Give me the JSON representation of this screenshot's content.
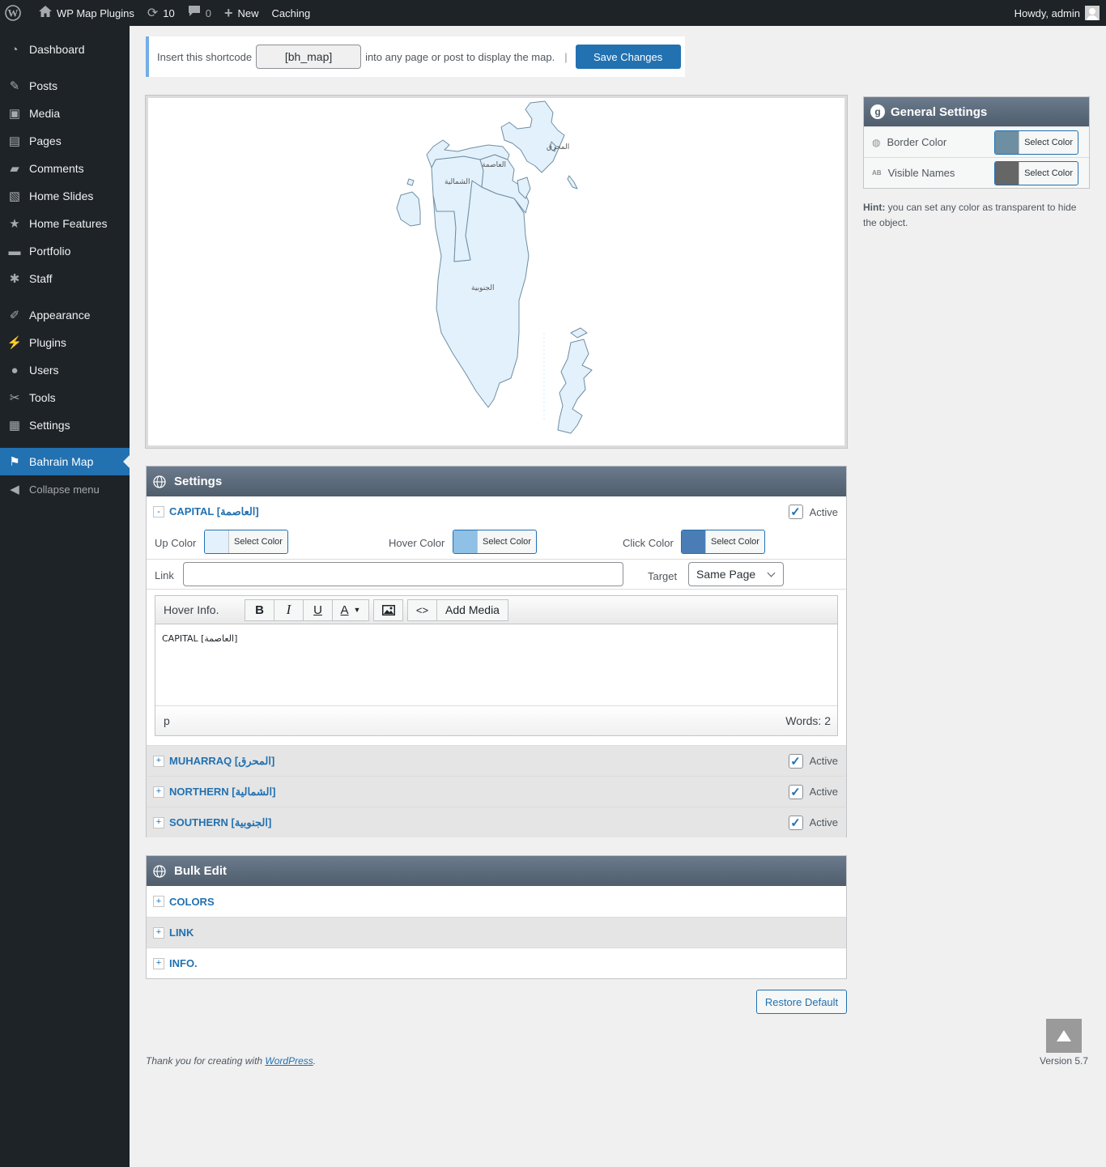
{
  "adminbar": {
    "site_name": "WP Map Plugins",
    "updates_count": "10",
    "comments_count": "0",
    "new_label": "New",
    "caching_label": "Caching",
    "howdy": "Howdy, admin"
  },
  "sidebar": {
    "items": [
      {
        "label": "Dashboard",
        "icon": "dashboard-icon"
      },
      {
        "label": "Posts",
        "icon": "pushpin-icon"
      },
      {
        "label": "Media",
        "icon": "media-icon"
      },
      {
        "label": "Pages",
        "icon": "page-icon"
      },
      {
        "label": "Comments",
        "icon": "comment-icon"
      },
      {
        "label": "Home Slides",
        "icon": "slides-icon"
      },
      {
        "label": "Home Features",
        "icon": "star-icon"
      },
      {
        "label": "Portfolio",
        "icon": "folder-icon"
      },
      {
        "label": "Staff",
        "icon": "paw-icon"
      },
      {
        "label": "Appearance",
        "icon": "brush-icon"
      },
      {
        "label": "Plugins",
        "icon": "plug-icon"
      },
      {
        "label": "Users",
        "icon": "user-icon"
      },
      {
        "label": "Tools",
        "icon": "wrench-icon"
      },
      {
        "label": "Settings",
        "icon": "settings-icon"
      },
      {
        "label": "Bahrain Map",
        "icon": "map-pin-icon"
      },
      {
        "label": "Collapse menu",
        "icon": "collapse-icon"
      }
    ]
  },
  "shortcode": {
    "prefix": "Insert this shortcode",
    "value": "[bh_map]",
    "suffix": "into any page or post to display the map.",
    "separator": "|",
    "save_label": "Save Changes"
  },
  "map": {
    "labels": {
      "muharraq": "المحرق",
      "capital": "العاصمة",
      "northern": "الشمالية",
      "southern": "الجنوبية"
    },
    "fill_color": "#e3f1fc",
    "border_color": "#6e8ea1"
  },
  "settings_panel": {
    "title": "Settings",
    "active_label": "Active",
    "capital": {
      "title": "CAPITAL [العاصمة]",
      "toggle": "-",
      "up_color_label": "Up Color",
      "up_color": "#e3f1fc",
      "hover_color_label": "Hover Color",
      "hover_color": "#8fc0e6",
      "click_color_label": "Click Color",
      "click_color": "#4a7db5",
      "select_color_label": "Select Color",
      "link_label": "Link",
      "link_value": "",
      "target_label": "Target",
      "target_value": "Same Page",
      "hover_info_label": "Hover Info.",
      "add_media_label": "Add Media",
      "editor_content": "CAPITAL [العاصمة]",
      "status_path": "p",
      "words": "Words: 2"
    },
    "regions": [
      {
        "title": "MUHARRAQ [المحرق]",
        "toggle": "+"
      },
      {
        "title": "NORTHERN [الشمالية]",
        "toggle": "+"
      },
      {
        "title": "SOUTHERN [الجنوبية]",
        "toggle": "+"
      }
    ]
  },
  "bulk_edit": {
    "title": "Bulk Edit",
    "items": [
      {
        "title": "COLORS",
        "toggle": "+"
      },
      {
        "title": "LINK",
        "toggle": "+"
      },
      {
        "title": "INFO.",
        "toggle": "+"
      }
    ]
  },
  "general_settings": {
    "title": "General Settings",
    "border_color_label": "Border Color",
    "border_color": "#6e8ea1",
    "visible_names_label": "Visible Names",
    "visible_names_color": "#666666",
    "select_color_label": "Select Color",
    "hint_bold": "Hint:",
    "hint_text": " you can set any color as transparent to hide the object."
  },
  "restore_label": "Restore Default",
  "footer": {
    "thanks_prefix": "Thank you for creating with ",
    "thanks_link": "WordPress",
    "thanks_suffix": ".",
    "version": "Version 5.7"
  }
}
